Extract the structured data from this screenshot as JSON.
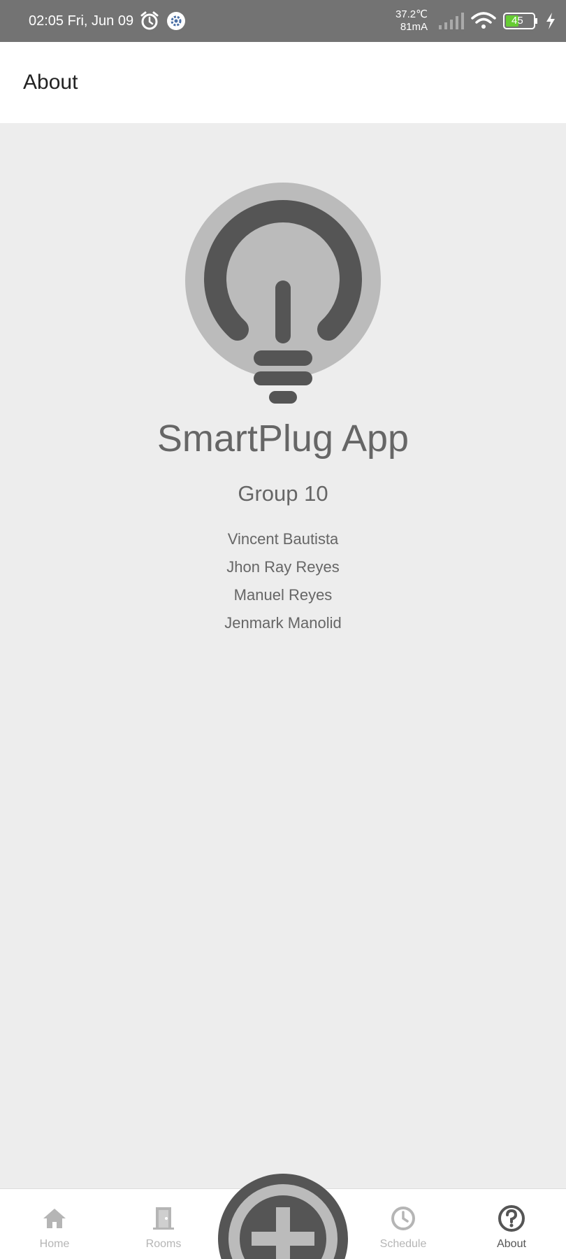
{
  "status_bar": {
    "time": "02:05 Fri, Jun 09",
    "temperature": "37.2℃",
    "current": "81mA",
    "battery": "45"
  },
  "header": {
    "title": "About"
  },
  "about": {
    "app_name": "SmartPlug App",
    "group": "Group 10",
    "members": [
      "Vincent Bautista",
      "Jhon Ray Reyes",
      "Manuel Reyes",
      "Jenmark Manolid"
    ]
  },
  "nav": {
    "items": [
      {
        "label": "Home",
        "icon": "home-icon"
      },
      {
        "label": "Rooms",
        "icon": "door-icon"
      },
      {
        "label": "Schedule",
        "icon": "clock-icon"
      },
      {
        "label": "About",
        "icon": "help-icon",
        "active": true
      }
    ],
    "fab_icon": "add-icon"
  },
  "colors": {
    "status_bar": "#737373",
    "background": "#ededed",
    "accent_dark": "#555555",
    "bulb_circle": "#bbbbbb",
    "battery_fill": "#66cc33"
  }
}
